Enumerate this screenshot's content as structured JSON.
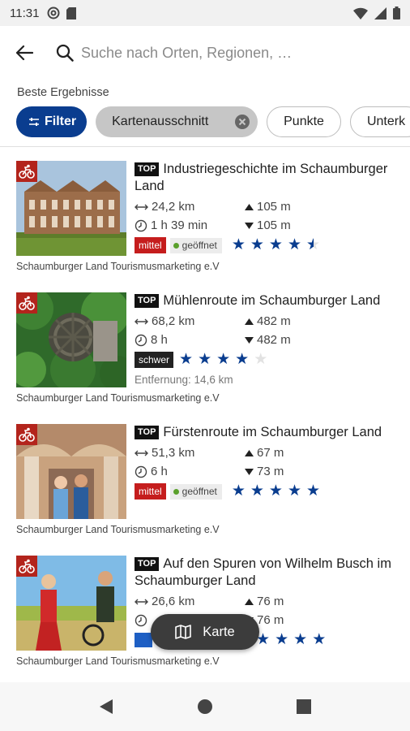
{
  "status_bar": {
    "time": "11:31"
  },
  "search": {
    "placeholder": "Suche nach Orten, Regionen, …"
  },
  "results_label": "Beste Ergebnisse",
  "chips": {
    "filter": "Filter",
    "selected": "Kartenausschnitt",
    "points": "Punkte",
    "partial": "Unterk"
  },
  "items": [
    {
      "badge": "TOP",
      "title": "Industriegeschichte im Schaumburger Land",
      "distance_len": "24,2 km",
      "duration": "1 h 39 min",
      "ascent": "105 m",
      "descent": "105 m",
      "difficulty": "mittel",
      "open_label": "geöffnet",
      "rating": 4.5,
      "source": "Schaumburger Land Tourismusmarketing e.V"
    },
    {
      "badge": "TOP",
      "title": "Mühlenroute im Schaumburger Land",
      "distance_len": "68,2 km",
      "duration": "8 h",
      "ascent": "482 m",
      "descent": "482 m",
      "difficulty": "schwer",
      "rating": 4,
      "distance_from": "Entfernung: 14,6 km",
      "source": "Schaumburger Land Tourismusmarketing e.V"
    },
    {
      "badge": "TOP",
      "title": "Fürstenroute im Schaumburger Land",
      "distance_len": "51,3 km",
      "duration": "6 h",
      "ascent": "67 m",
      "descent": "73 m",
      "difficulty": "mittel",
      "open_label": "geöffnet",
      "rating": 5,
      "source": "Schaumburger Land Tourismusmarketing e.V"
    },
    {
      "badge": "TOP",
      "title": "Auf den Spuren von Wilhelm Busch im Schaumburger Land",
      "distance_len": "26,6 km",
      "duration": "",
      "ascent": "76 m",
      "descent": "76 m",
      "difficulty": "",
      "rating": 5,
      "source": "Schaumburger Land Tourismusmarketing e.V"
    }
  ],
  "map_button": "Karte",
  "colors": {
    "primary": "#0a3d8f",
    "badge_red": "#b3241c",
    "mittel": "#c51d1d",
    "schwer": "#222222"
  },
  "icons": [
    "back-arrow-icon",
    "search-icon",
    "filter-icon",
    "close-icon",
    "bike-icon",
    "distance-icon",
    "clock-icon",
    "ascent-icon",
    "descent-icon",
    "map-icon",
    "nav-back-icon",
    "nav-home-icon",
    "nav-recents-icon"
  ]
}
